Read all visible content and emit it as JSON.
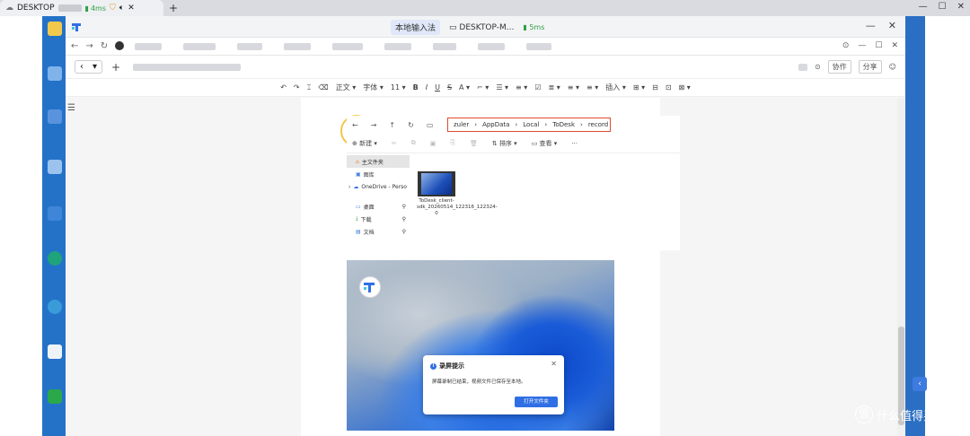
{
  "browser": {
    "tab_title": "DESKTOP",
    "tab_ping": "4ms",
    "new_tab": "+",
    "controls": {
      "minimize": "—",
      "maximize": "☐",
      "close": "✕"
    }
  },
  "todesk": {
    "ime_label": "本地输入法",
    "desktop_label": "DESKTOP-M...",
    "ping": "5ms",
    "controls": {
      "minimize": "—",
      "close": "✕"
    }
  },
  "inner": {
    "right_controls": [
      "⊙",
      "—",
      "☐",
      "✕"
    ],
    "collab": "协作",
    "share": "分享"
  },
  "format_bar": {
    "items": [
      "↶",
      "↷",
      "⌶",
      "⌫",
      "正文 ▾",
      "字体 ▾",
      "11 ▾",
      "B",
      "I",
      "U",
      "S",
      "A ▾",
      "⌐ ▾",
      "☰ ▾",
      "≡ ▾",
      "☑",
      "≣ ▾",
      "≡ ▾",
      "≡ ▾",
      "插入 ▾",
      "⊞ ▾",
      "⊟",
      "⊡",
      "⊠ ▾"
    ]
  },
  "explorer": {
    "path": [
      "zuler",
      "AppData",
      "Local",
      "ToDesk",
      "record"
    ],
    "toolbar": {
      "new": "⊕ 新建 ▾",
      "sort": "⇅ 排序 ▾",
      "view": "▭ 查看 ▾",
      "more": "···"
    },
    "sidebar": [
      {
        "label": "主文件夹",
        "selected": true
      },
      {
        "label": "图库",
        "selected": false
      },
      {
        "label": "OneDrive - Perso",
        "selected": false
      },
      {
        "label": "桌面",
        "selected": false
      },
      {
        "label": "下载",
        "selected": false
      },
      {
        "label": "文档",
        "selected": false
      }
    ],
    "file_name": "ToDesk_client-sdk_20260514_122316_122324-0"
  },
  "dialog": {
    "title": "录屏提示",
    "message": "屏幕录制已结束，视频文件已保存至本地。",
    "button": "打开文件夹",
    "close": "✕"
  },
  "watermark": {
    "badge": "值",
    "text": "什么值得买"
  },
  "colors": {
    "desktop_blue": "#1e6fc9",
    "accent_blue": "#2f6fe4",
    "highlight_red": "#e04a2f",
    "ping_green": "#2f9e44"
  }
}
